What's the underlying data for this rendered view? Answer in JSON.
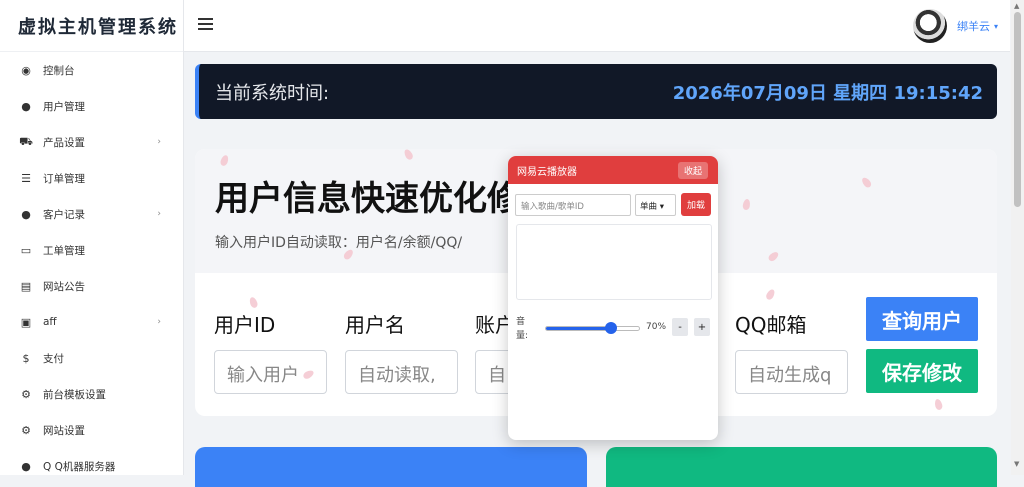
{
  "app": {
    "brand": "虚拟主机管理系统"
  },
  "sidebar": {
    "items": [
      {
        "label": "控制台",
        "icon": "dashboard-icon",
        "glyph": "◉",
        "chevron": false
      },
      {
        "label": "用户管理",
        "icon": "user-icon",
        "glyph": "●",
        "chevron": false
      },
      {
        "label": "产品设置",
        "icon": "cart-icon",
        "glyph": "⛟",
        "chevron": true
      },
      {
        "label": "订单管理",
        "icon": "list-icon",
        "glyph": "☰",
        "chevron": false
      },
      {
        "label": "客户记录",
        "icon": "user-icon",
        "glyph": "●",
        "chevron": true
      },
      {
        "label": "工单管理",
        "icon": "message-icon",
        "glyph": "▭",
        "chevron": false
      },
      {
        "label": "网站公告",
        "icon": "announcement-icon",
        "glyph": "▤",
        "chevron": false
      },
      {
        "label": "aff",
        "icon": "ticket-icon",
        "glyph": "▣",
        "chevron": true
      },
      {
        "label": "支付",
        "icon": "dollar-icon",
        "glyph": "$",
        "chevron": false
      },
      {
        "label": "前台模板设置",
        "icon": "gear-icon",
        "glyph": "⚙",
        "chevron": false
      },
      {
        "label": "网站设置",
        "icon": "gear-icon",
        "glyph": "⚙",
        "chevron": false
      },
      {
        "label": "Q Q机器服务器",
        "icon": "server-icon",
        "glyph": "●",
        "chevron": false
      }
    ],
    "chevron_glyph": "›"
  },
  "topbar": {
    "username": "绑羊云",
    "caret": "▾"
  },
  "time_banner": {
    "label": "当前系统时间:",
    "value": "2026年07月09日 星期四 19:15:42"
  },
  "main": {
    "title": "用户信息快速优化修",
    "subtitle": "输入用户ID自动读取：用户名/余额/QQ/",
    "fields": [
      {
        "label": "用户ID",
        "placeholder": "输入用户"
      },
      {
        "label": "用户名",
        "placeholder": "自动读取,"
      },
      {
        "label": "账户",
        "placeholder": "自"
      },
      {
        "label": "QQ邮箱",
        "placeholder": "自动生成q"
      }
    ],
    "query_button": "查询用户",
    "save_button": "保存修改"
  },
  "player": {
    "title": "网易云播放器",
    "collapse": "收起",
    "input_placeholder": "输入歌曲/歌单ID",
    "mode": "单曲 ▾",
    "load": "加载",
    "volume_label": "音量:",
    "volume_percent": "70%",
    "volume_value": 0.7,
    "minus": "-",
    "plus": "+"
  },
  "colors": {
    "accent": "#3b82f6",
    "success": "#10b981",
    "player_red": "#e03e3e",
    "banner_bg": "#111827"
  }
}
